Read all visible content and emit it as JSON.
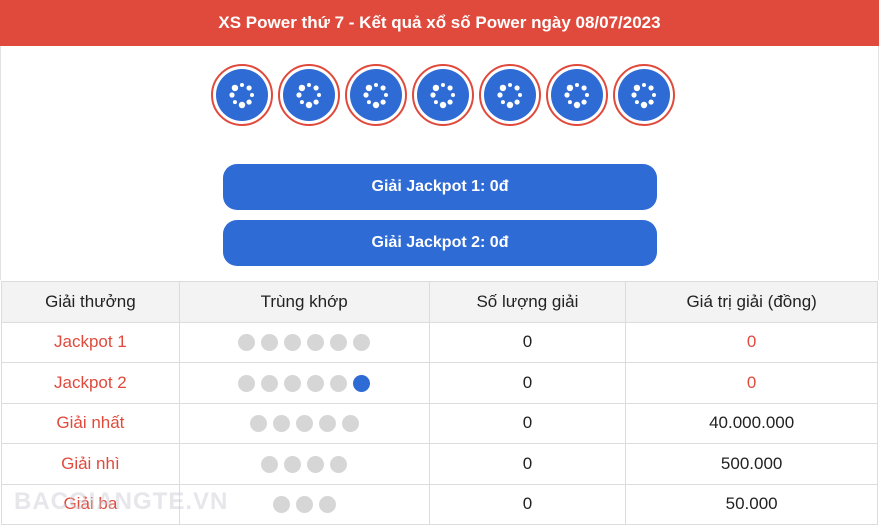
{
  "header": {
    "title": "XS Power thứ 7 - Kết quả xổ số Power ngày 08/07/2023"
  },
  "balls": {
    "count": 7,
    "icon": "loading-spinner-icon",
    "colors": {
      "ball": "#2f6bd4",
      "ring": "#e04a3c"
    }
  },
  "jackpots": [
    {
      "label": "Giải Jackpot 1: 0đ"
    },
    {
      "label": "Giải Jackpot 2: 0đ"
    }
  ],
  "table": {
    "headers": [
      "Giải thưởng",
      "Trùng khớp",
      "Số lượng giải",
      "Giá trị giải (đồng)"
    ],
    "rows": [
      {
        "prize": "Jackpot 1",
        "match_dots": 6,
        "special": false,
        "count": "0",
        "value": "0",
        "value_red": true
      },
      {
        "prize": "Jackpot 2",
        "match_dots": 5,
        "special": true,
        "count": "0",
        "value": "0",
        "value_red": true
      },
      {
        "prize": "Giải nhất",
        "match_dots": 5,
        "special": false,
        "count": "0",
        "value": "40.000.000",
        "value_red": false
      },
      {
        "prize": "Giải nhì",
        "match_dots": 4,
        "special": false,
        "count": "0",
        "value": "500.000",
        "value_red": false
      },
      {
        "prize": "Giải ba",
        "match_dots": 3,
        "special": false,
        "count": "0",
        "value": "50.000",
        "value_red": false
      }
    ]
  },
  "watermark": "BACGIANGTE.VN",
  "colors": {
    "accent": "#e04a3c",
    "primary": "#2f6bd4",
    "dot_grey": "#d6d6d6"
  }
}
